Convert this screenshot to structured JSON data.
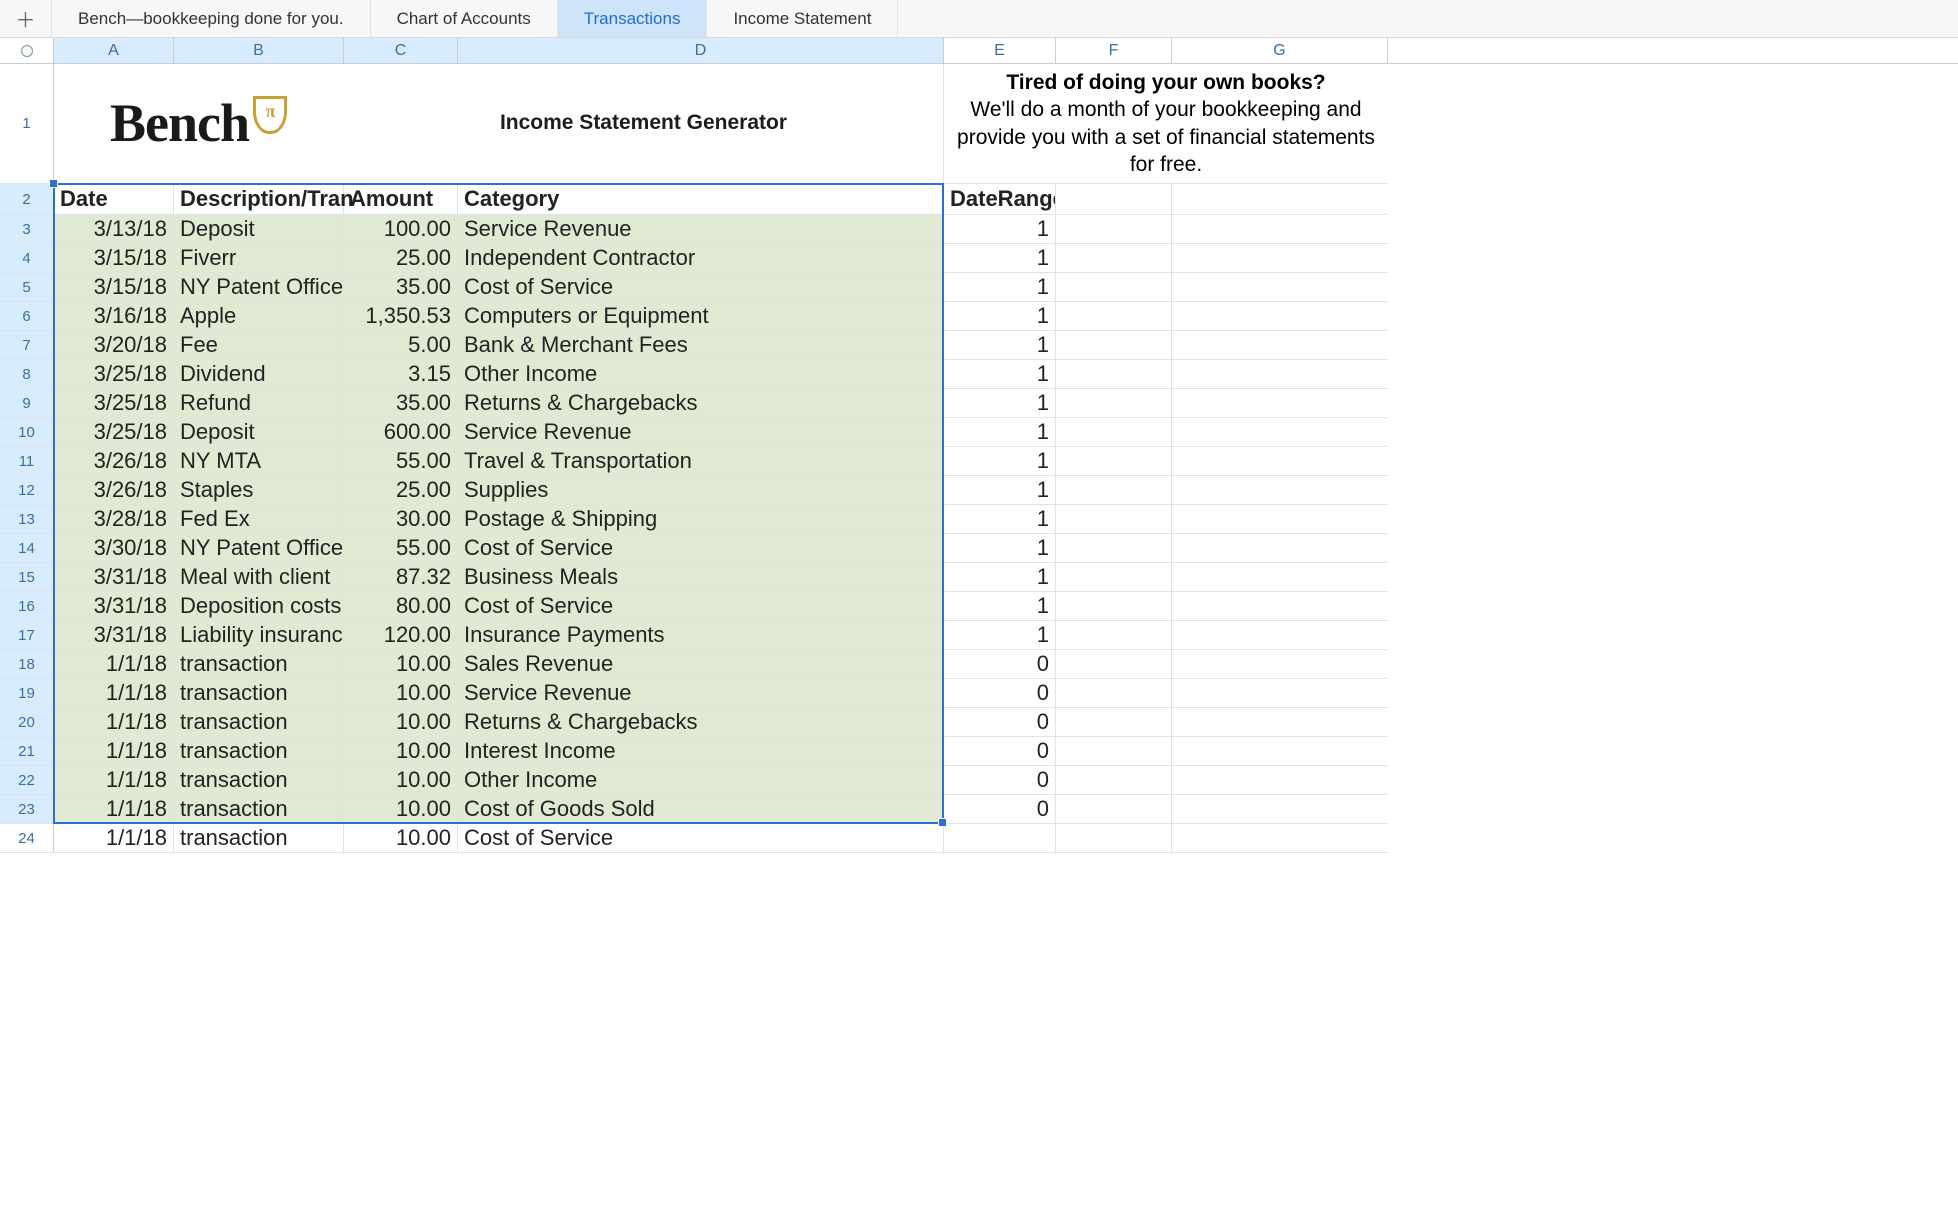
{
  "tabs": [
    {
      "label": "Bench—bookkeeping done for you.",
      "active": false
    },
    {
      "label": "Chart of Accounts",
      "active": false
    },
    {
      "label": "Transactions",
      "active": true
    },
    {
      "label": "Income Statement",
      "active": false
    }
  ],
  "columns": [
    "A",
    "B",
    "C",
    "D",
    "E",
    "F",
    "G"
  ],
  "row1": {
    "logo_text": "Bench",
    "logo_pi": "π",
    "title": "Income Statement Generator",
    "promo_bold": "Tired of doing your own books?",
    "promo_rest": "We'll do a month of your bookkeeping and provide you with a set of financial statements for free."
  },
  "headers": {
    "date": "Date",
    "desc": "Description/Tran",
    "amount": "Amount",
    "category": "Category",
    "daterange": "DateRange"
  },
  "rows": [
    {
      "n": 3,
      "date": "3/13/18",
      "desc": "Deposit",
      "amount": "100.00",
      "category": "Service Revenue",
      "dr": "1",
      "green": true
    },
    {
      "n": 4,
      "date": "3/15/18",
      "desc": "Fiverr",
      "amount": "25.00",
      "category": "Independent Contractor",
      "dr": "1",
      "green": true
    },
    {
      "n": 5,
      "date": "3/15/18",
      "desc": "NY Patent Office",
      "amount": "35.00",
      "category": "Cost of Service",
      "dr": "1",
      "green": true
    },
    {
      "n": 6,
      "date": "3/16/18",
      "desc": "Apple",
      "amount": "1,350.53",
      "category": "Computers or Equipment",
      "dr": "1",
      "green": true
    },
    {
      "n": 7,
      "date": "3/20/18",
      "desc": "Fee",
      "amount": "5.00",
      "category": "Bank & Merchant Fees",
      "dr": "1",
      "green": true
    },
    {
      "n": 8,
      "date": "3/25/18",
      "desc": "Dividend",
      "amount": "3.15",
      "category": "Other Income",
      "dr": "1",
      "green": true
    },
    {
      "n": 9,
      "date": "3/25/18",
      "desc": "Refund",
      "amount": "35.00",
      "category": "Returns & Chargebacks",
      "dr": "1",
      "green": true
    },
    {
      "n": 10,
      "date": "3/25/18",
      "desc": "Deposit",
      "amount": "600.00",
      "category": "Service Revenue",
      "dr": "1",
      "green": true
    },
    {
      "n": 11,
      "date": "3/26/18",
      "desc": "NY MTA",
      "amount": "55.00",
      "category": "Travel & Transportation",
      "dr": "1",
      "green": true
    },
    {
      "n": 12,
      "date": "3/26/18",
      "desc": "Staples",
      "amount": "25.00",
      "category": "Supplies",
      "dr": "1",
      "green": true
    },
    {
      "n": 13,
      "date": "3/28/18",
      "desc": "Fed Ex",
      "amount": "30.00",
      "category": "Postage & Shipping",
      "dr": "1",
      "green": true
    },
    {
      "n": 14,
      "date": "3/30/18",
      "desc": "NY Patent Office",
      "amount": "55.00",
      "category": "Cost of Service",
      "dr": "1",
      "green": true
    },
    {
      "n": 15,
      "date": "3/31/18",
      "desc": "Meal with client",
      "amount": "87.32",
      "category": "Business Meals",
      "dr": "1",
      "green": true
    },
    {
      "n": 16,
      "date": "3/31/18",
      "desc": "Deposition costs",
      "amount": "80.00",
      "category": "Cost of Service",
      "dr": "1",
      "green": true
    },
    {
      "n": 17,
      "date": "3/31/18",
      "desc": "Liability insuranc",
      "amount": "120.00",
      "category": "Insurance Payments",
      "dr": "1",
      "green": true
    },
    {
      "n": 18,
      "date": "1/1/18",
      "desc": "transaction",
      "amount": "10.00",
      "category": "Sales Revenue",
      "dr": "0",
      "green": true
    },
    {
      "n": 19,
      "date": "1/1/18",
      "desc": "transaction",
      "amount": "10.00",
      "category": "Service Revenue",
      "dr": "0",
      "green": true
    },
    {
      "n": 20,
      "date": "1/1/18",
      "desc": "transaction",
      "amount": "10.00",
      "category": "Returns & Chargebacks",
      "dr": "0",
      "green": true
    },
    {
      "n": 21,
      "date": "1/1/18",
      "desc": "transaction",
      "amount": "10.00",
      "category": "Interest Income",
      "dr": "0",
      "green": true
    },
    {
      "n": 22,
      "date": "1/1/18",
      "desc": "transaction",
      "amount": "10.00",
      "category": "Other Income",
      "dr": "0",
      "green": true
    },
    {
      "n": 23,
      "date": "1/1/18",
      "desc": "transaction",
      "amount": "10.00",
      "category": "Cost of Goods Sold",
      "dr": "0",
      "green": true
    },
    {
      "n": 24,
      "date": "1/1/18",
      "desc": "transaction",
      "amount": "10.00",
      "category": "Cost of Service",
      "dr": "",
      "green": false
    }
  ]
}
